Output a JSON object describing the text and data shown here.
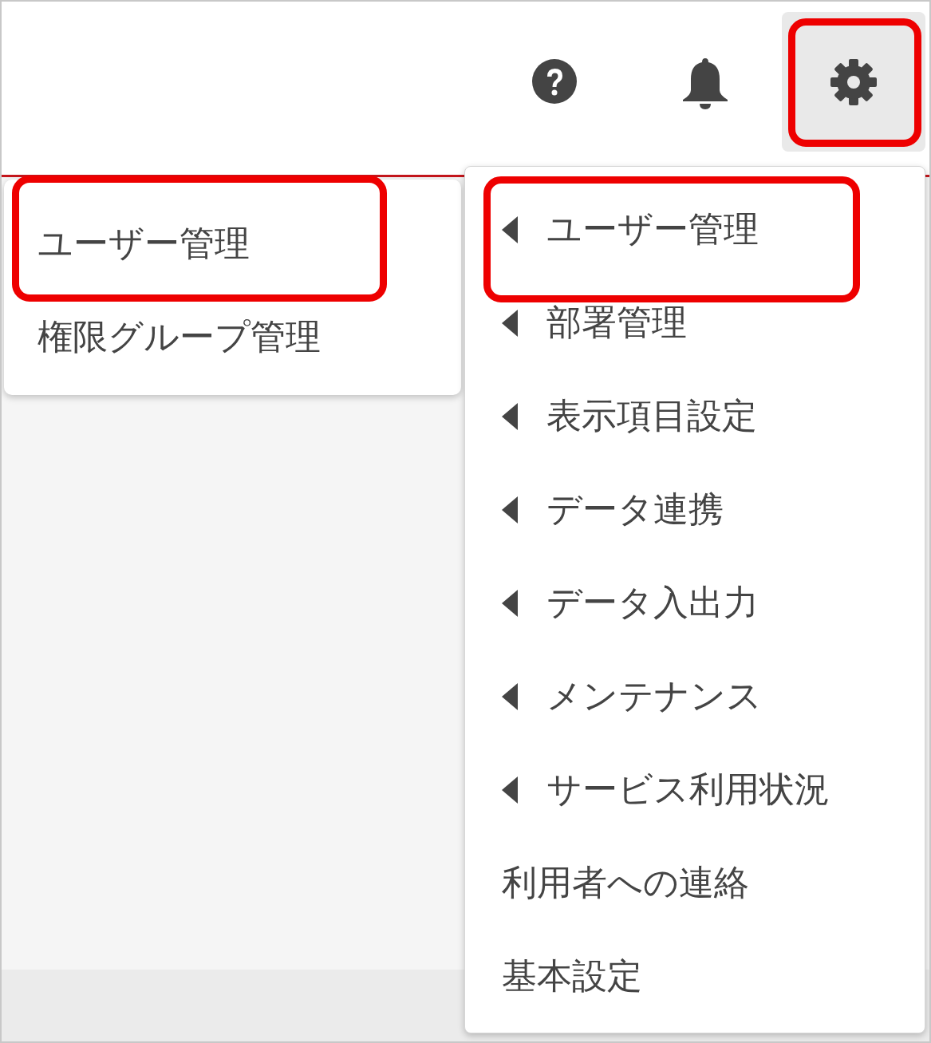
{
  "toolbar": {
    "settings_button": {
      "selected": true,
      "highlighted": true
    }
  },
  "submenu": {
    "items": [
      {
        "label": "ユーザー管理",
        "highlighted": true
      },
      {
        "label": "権限グループ管理",
        "highlighted": false
      }
    ]
  },
  "settings_menu": {
    "items": [
      {
        "label": "ユーザー管理",
        "has_submenu": true,
        "highlighted": true
      },
      {
        "label": "部署管理",
        "has_submenu": true,
        "highlighted": false
      },
      {
        "label": "表示項目設定",
        "has_submenu": true,
        "highlighted": false
      },
      {
        "label": "データ連携",
        "has_submenu": true,
        "highlighted": false
      },
      {
        "label": "データ入出力",
        "has_submenu": true,
        "highlighted": false
      },
      {
        "label": "メンテナンス",
        "has_submenu": true,
        "highlighted": false
      },
      {
        "label": "サービス利用状況",
        "has_submenu": true,
        "highlighted": false
      },
      {
        "label": "利用者への連絡",
        "has_submenu": false,
        "highlighted": false
      },
      {
        "label": "基本設定",
        "has_submenu": false,
        "highlighted": false
      }
    ]
  }
}
